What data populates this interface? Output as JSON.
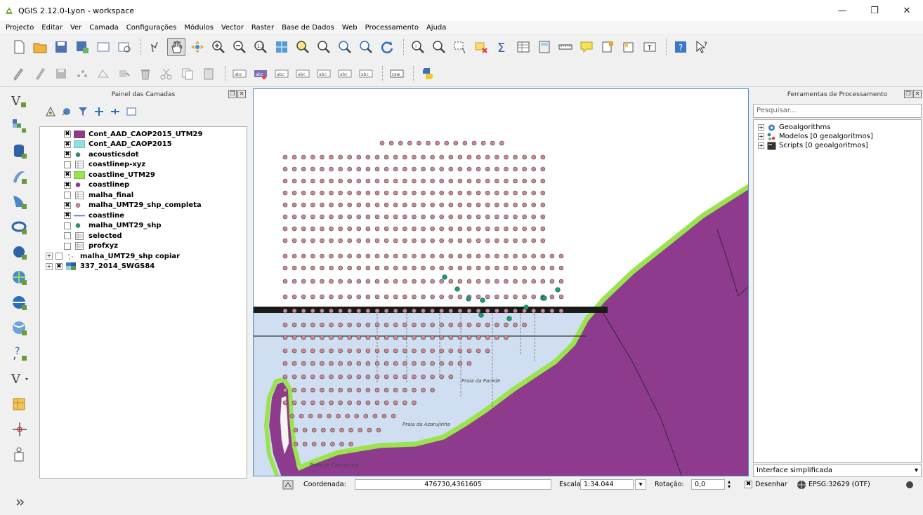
{
  "window": {
    "title": "QGIS 2.12.0-Lyon - workspace",
    "minimize": "—",
    "maximize": "❐",
    "close": "✕"
  },
  "menu": [
    "Projecto",
    "Editar",
    "Ver",
    "Camada",
    "Configurações",
    "Módulos",
    "Vector",
    "Raster",
    "Base de Dados",
    "Web",
    "Processamento",
    "Ajuda"
  ],
  "toolbar2": {
    "csw_label": "csw",
    "abc_label": "abc"
  },
  "layers_panel": {
    "title": "Painel das Camadas",
    "layers": [
      {
        "name": "Cont_AAD_CAOP2015_UTM29",
        "checked": true,
        "symbol": "fill",
        "color": "#8e3b8e",
        "expander": "",
        "indent": 1
      },
      {
        "name": "Cont_AAD_CAOP2015",
        "checked": true,
        "symbol": "fill",
        "color": "#8fe0df",
        "expander": "",
        "indent": 1
      },
      {
        "name": "acousticsdot",
        "checked": true,
        "symbol": "point",
        "color": "#1b9e72",
        "expander": "",
        "indent": 1
      },
      {
        "name": "coastlinep-xyz",
        "checked": false,
        "symbol": "table",
        "color": "#bbbbbb",
        "expander": "",
        "indent": 1
      },
      {
        "name": "coastline_UTM29",
        "checked": true,
        "symbol": "fill",
        "color": "#9be34e",
        "expander": "",
        "indent": 1
      },
      {
        "name": "coastlinep",
        "checked": true,
        "symbol": "point",
        "color": "#8a3c9a",
        "expander": "",
        "indent": 1
      },
      {
        "name": "malha_final",
        "checked": false,
        "symbol": "table",
        "color": "#bbbbbb",
        "expander": "",
        "indent": 1
      },
      {
        "name": "malha_UMT29_shp_completa",
        "checked": true,
        "symbol": "point",
        "color": "#d9888f",
        "expander": "",
        "indent": 1
      },
      {
        "name": "coastline",
        "checked": true,
        "symbol": "line",
        "color": "#3d6fb5",
        "expander": "",
        "indent": 1
      },
      {
        "name": "malha_UMT29_shp",
        "checked": false,
        "symbol": "point",
        "color": "#1b9e72",
        "expander": "",
        "indent": 1
      },
      {
        "name": "selected",
        "checked": false,
        "symbol": "table",
        "color": "#bbbbbb",
        "expander": "",
        "indent": 1
      },
      {
        "name": "profxyz",
        "checked": false,
        "symbol": "table",
        "color": "#bbbbbb",
        "expander": "",
        "indent": 1
      },
      {
        "name": "malha_UMT29_shp copiar",
        "checked": false,
        "symbol": "dots",
        "color": "#999999",
        "expander": "+",
        "indent": 0
      },
      {
        "name": "337_2014_SWGS84",
        "checked": true,
        "symbol": "raster",
        "color": "#3f7fbf",
        "expander": "+",
        "indent": 0
      }
    ]
  },
  "map": {
    "sea_color": "#cfdef0",
    "land_color": "#8e3b8e",
    "coast_color": "#9be34e",
    "grid_color": "#cf8890",
    "acoustic_color": "#1b9e72",
    "labels": [
      "Praia da Parede",
      "Praia da Azarujinha",
      "Praia de Carcavelos"
    ]
  },
  "processing_panel": {
    "title": "Ferramentas de Processamento",
    "search_placeholder": "Pesquisar...",
    "tree": [
      {
        "label": "Geoalgorithms",
        "icon": "gear-icon"
      },
      {
        "label": "Modelos [0 geoalgoritmos]",
        "icon": "models-icon"
      },
      {
        "label": "Scripts [0 geoalgoritmos]",
        "icon": "scripts-icon"
      }
    ],
    "mode": "Interface simplificada"
  },
  "status": {
    "coord_label": "Coordenada:",
    "coord_value": "476730,4361605",
    "scale_label": "Escala",
    "scale_value": "1:34.044",
    "rotation_label": "Rotação:",
    "rotation_value": "0,0",
    "render_label": "Desenhar",
    "crs": "EPSG:32629 (OTF)"
  }
}
